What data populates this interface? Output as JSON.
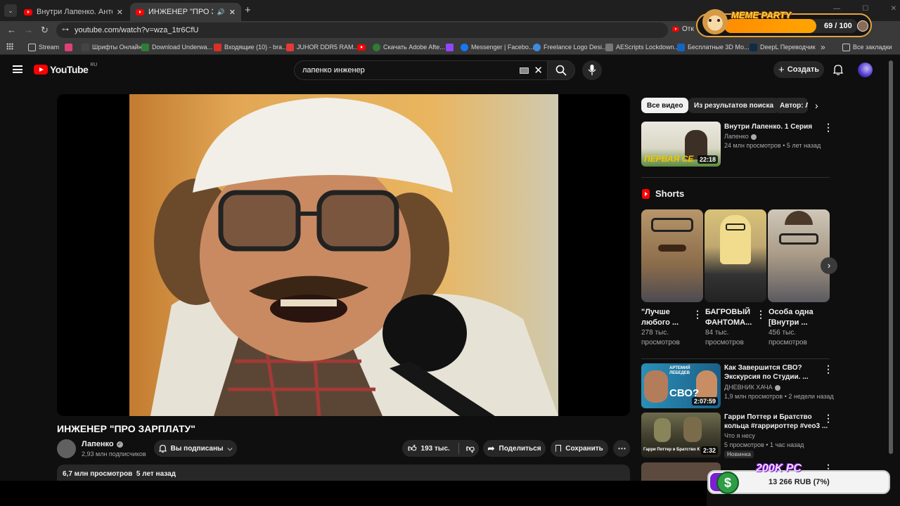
{
  "browser": {
    "tabs": [
      {
        "title": "Внутри Лапенко. Антон о пон"
      },
      {
        "title": "ИНЖЕНЕР \"ПРО ЗАРПЛАТУ\""
      }
    ],
    "new_tab_label": "+",
    "url": "youtube.com/watch?v=wza_1tr6CfU",
    "open_label": "Отк",
    "bookmarks": [
      {
        "label": "Stream",
        "color": "#c8c8c8"
      },
      {
        "label": "",
        "color": "#e0407a"
      },
      {
        "label": "Шрифты Онлайн",
        "color": "#444444"
      },
      {
        "label": "Download Underwa...",
        "color": "#2e7d32"
      },
      {
        "label": "Входящие (10) - bra...",
        "color": "#d93025"
      },
      {
        "label": "JUHOR DDR5 RAM...",
        "color": "#e53935"
      },
      {
        "label": "",
        "color": "#ff0000"
      },
      {
        "label": "Скачать Adobe Afte...",
        "color": "#2e7d32"
      },
      {
        "label": "",
        "color": "#9146ff"
      },
      {
        "label": "Messenger | Facebo...",
        "color": "#1877f2"
      },
      {
        "label": "Freelance Logo Desi...",
        "color": "#3d8bd9"
      },
      {
        "label": "AEScripts Lockdown...",
        "color": "#777777"
      },
      {
        "label": "Бесплатные 3D Мо...",
        "color": "#1565c0"
      },
      {
        "label": "DeepL Переводчик",
        "color": "#0f2b46"
      }
    ],
    "more_bookmarks": "»",
    "all_bookmarks": "Все закладки"
  },
  "youtube": {
    "logo_text": "YouTube",
    "region": "RU",
    "search_value": "лапенко инженер",
    "create_label": "Создать",
    "video": {
      "title": "ИНЖЕНЕР \"ПРО ЗАРПЛАТУ\"",
      "channel": "Лапенко",
      "subscribers": "2,93 млн подписчиков",
      "subscribed_label": "Вы подписаны",
      "likes": "193 тыс.",
      "share_label": "Поделиться",
      "save_label": "Сохранить",
      "views_date": "6,7 млн просмотров  5 лет назад"
    },
    "chips": [
      "Все видео",
      "Из результатов поиска",
      "Автор: Л"
    ],
    "related_top": {
      "title": "Внутри Лапенко. 1 Серия",
      "channel": "Лапенко",
      "meta": "24 млн просмотров • 5 лет назад",
      "duration": "22:18",
      "thumb_text": "ПЕРВАЯ СЕ"
    },
    "shorts_label": "Shorts",
    "shorts": [
      {
        "title_1": "\"Лучше",
        "title_2": "любого ...",
        "meta_1": "278 тыс.",
        "meta_2": "просмотров"
      },
      {
        "title_1": "БАГРОВЫЙ",
        "title_2": "ФАНТОМА...",
        "meta_1": "84 тыс.",
        "meta_2": "просмотров"
      },
      {
        "title_1": "Особа одна",
        "title_2": "[Внутри ...",
        "meta_1": "456 тыс.",
        "meta_2": "просмотров"
      }
    ],
    "related": [
      {
        "title_1": "Как Завершится СВО?",
        "title_2": "Экскурсия по Студии. ...",
        "channel": "ДНЕВНИК ХАЧА",
        "meta": "1,9 млн просмотров • 2 недели назад",
        "duration": "2:07:59",
        "thumb_text_1": "АРТЕМИЙ",
        "thumb_text_2": "ЛЕБЕДЕВ",
        "thumb_text_3": "СВО?",
        "badge": ""
      },
      {
        "title_1": "Гарри Поттер и Братство",
        "title_2": "кольца #гарриpоттер #veo3 ...",
        "channel": "Что я несу",
        "meta": "5 просмотров • 1 час назад",
        "duration": "2:32",
        "thumb_text_1": "Гарри Поттер и Братство К",
        "thumb_text_2": "",
        "thumb_text_3": "",
        "badge": "Новинка"
      }
    ]
  },
  "overlays": {
    "meme_title": "MEME PARTY",
    "meme_progress": "69 / 100",
    "meme_fill": 0.69,
    "pc_title": "200K PC",
    "pc_amount": "13 266 RUB (7%)",
    "pc_fill": 0.07
  }
}
